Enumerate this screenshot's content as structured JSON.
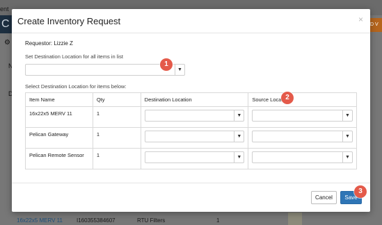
{
  "background": {
    "breadcrumb_fragment": "ent",
    "app_initial": "C",
    "orange_button_fragment": "DD V",
    "left_letter_1": "N",
    "left_letter_2": "D",
    "row": {
      "item_link": "16x22x5 MERV 11",
      "code": "I160355384607",
      "category": "RTU Filters",
      "qty": "1"
    }
  },
  "modal": {
    "title": "Create Inventory Request",
    "close_glyph": "×",
    "requestor": "Requestor: Lizzie Z",
    "set_all_label": "Set Destination Location for all items in list",
    "all_select_value": "",
    "for_items_label": "Select Destination Location for items below:",
    "table": {
      "headers": {
        "item_name": "Item Name",
        "qty": "Qty",
        "destination": "Destination Location",
        "source": "Source Location"
      },
      "rows": [
        {
          "item_name": "16x22x5 MERV 11",
          "qty": "1",
          "destination": "",
          "source": ""
        },
        {
          "item_name": "Pelican Gateway",
          "qty": "1",
          "destination": "",
          "source": ""
        },
        {
          "item_name": "Pelican Remote Sensor",
          "qty": "1",
          "destination": "",
          "source": ""
        }
      ]
    },
    "buttons": {
      "cancel": "Cancel",
      "save": "Save"
    }
  },
  "callouts": [
    "1",
    "2",
    "3"
  ],
  "icons": {
    "dropdown": "caret-down-icon",
    "close": "close-icon",
    "settings": "gear-icon"
  },
  "colors": {
    "primary": "#2e75b6",
    "callout": "#e45a4a",
    "nav_dark": "#1d2f40",
    "accent_orange": "#b5651d"
  }
}
